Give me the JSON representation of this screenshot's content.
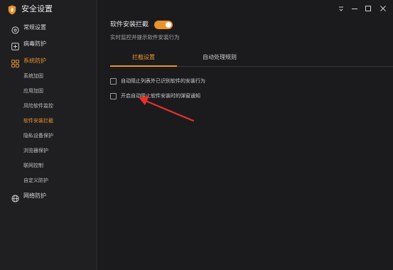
{
  "window": {
    "title": "安全设置",
    "controls": [
      "menu-icon",
      "minimize-icon",
      "maximize-icon",
      "close-icon"
    ]
  },
  "sidebar": {
    "items": [
      {
        "label": "常规设置",
        "icon": "gear-circle-icon"
      },
      {
        "label": "病毒防护",
        "icon": "plus-square-icon"
      },
      {
        "label": "系统防护",
        "icon": "grid-icon",
        "active": true
      },
      {
        "label": "网络防护",
        "icon": "globe-icon"
      }
    ],
    "sub_items": [
      {
        "label": "系统加固"
      },
      {
        "label": "应用加固"
      },
      {
        "label": "风险软件监控"
      },
      {
        "label": "软件安装拦截",
        "active": true
      },
      {
        "label": "隐私设备保护"
      },
      {
        "label": "浏览器保护"
      },
      {
        "label": "联网控制"
      },
      {
        "label": "自定义防护"
      }
    ]
  },
  "main": {
    "title": "软件安装拦截",
    "toggle_on": true,
    "description": "实时监控并提示软件安装行为",
    "tabs": [
      {
        "label": "拦截设置",
        "active": true
      },
      {
        "label": "自动处理规则",
        "active": false
      }
    ],
    "options": [
      {
        "label": "自动阻止列表外已识别软件的安装行为",
        "checked": false
      },
      {
        "label": "开启自动阻止软件安装时的弹窗通知",
        "checked": false
      }
    ]
  },
  "colors": {
    "accent": "#e8932c",
    "background": "#1b1b1e",
    "sidebar": "#1f1f22",
    "arrow": "#e8302a"
  }
}
